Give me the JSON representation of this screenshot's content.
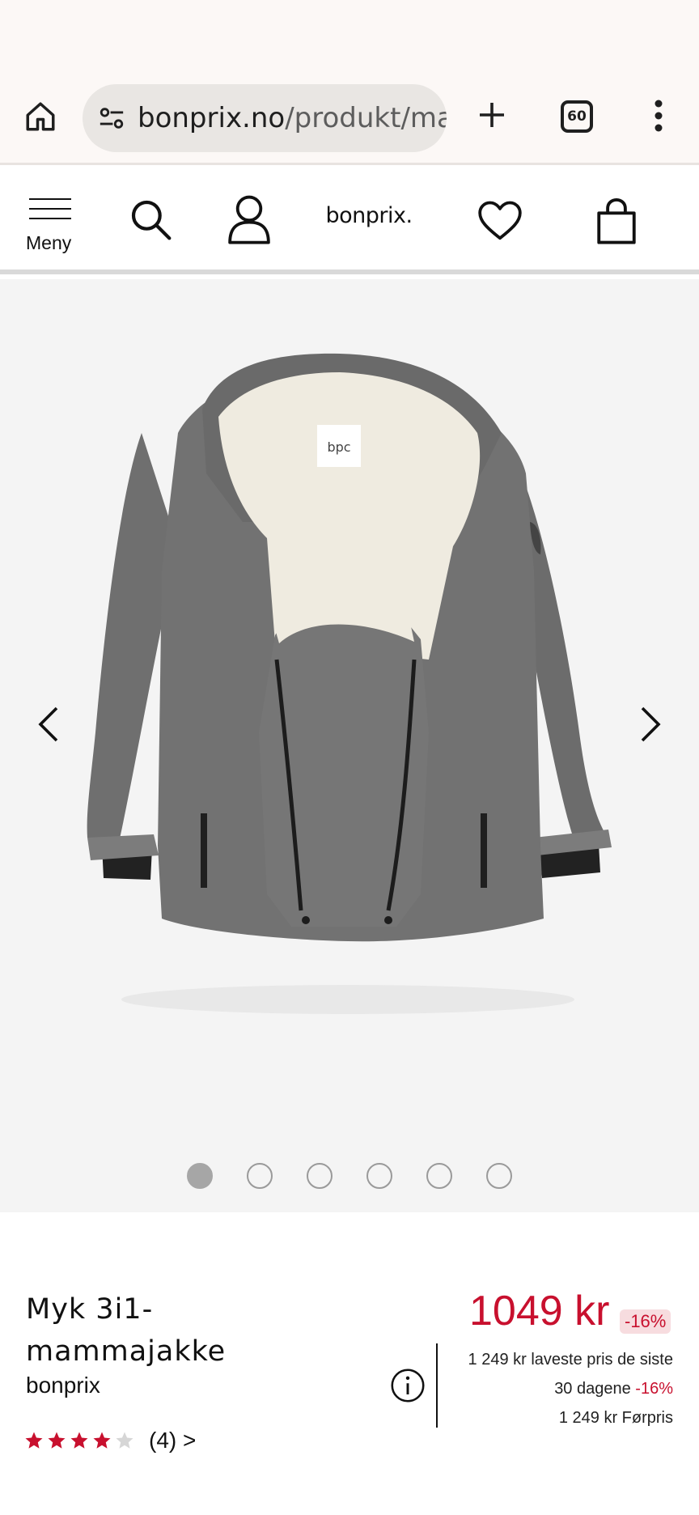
{
  "browser": {
    "url_domain": "bonprix.no",
    "url_path": "/produkt/mammajakke",
    "tab_count": "60"
  },
  "header": {
    "menu_label": "Meny",
    "logo_text": "bonprix."
  },
  "gallery": {
    "image_description": "grey-jacket-image",
    "label_text": "bpc",
    "dot_count": 6,
    "active_index": 0
  },
  "product": {
    "title": "Myk 3i1-mammajakke",
    "brand": "bonprix",
    "rating": 4,
    "rating_max": 5,
    "review_count": "(4) >",
    "price": "1049 kr",
    "discount": "-16%",
    "lowest_price_line": "1 249 kr laveste pris de siste",
    "lowest_price_days": "30 dagene",
    "lowest_price_discount": "-16%",
    "before_price": "1 249 kr Førpris"
  },
  "colors": {
    "accent_red": "#c8102e",
    "gallery_bg": "#f4f4f4",
    "chrome_bg": "#fcf8f6"
  }
}
